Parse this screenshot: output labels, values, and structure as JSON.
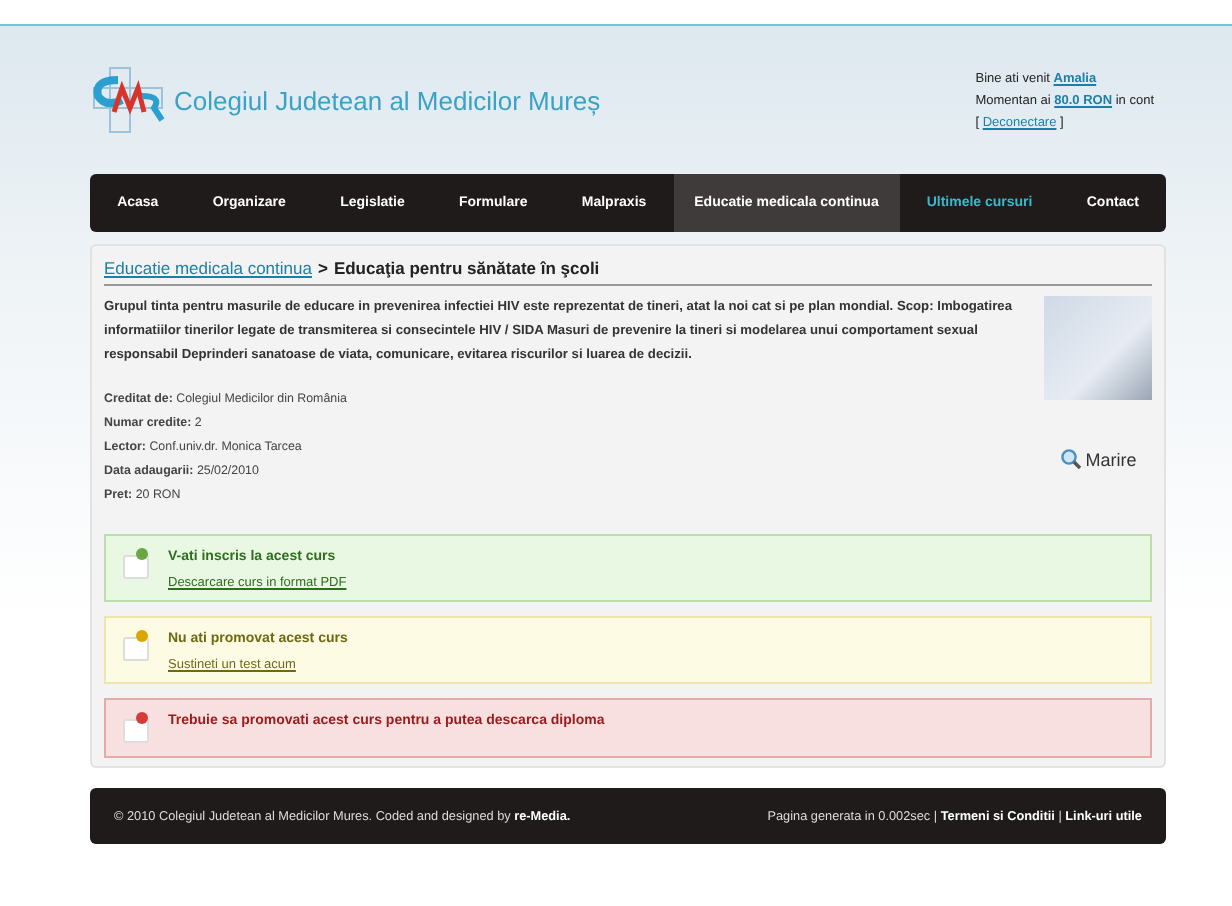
{
  "header": {
    "site_title": "Colegiul Judetean al Medicilor Mureș",
    "user": {
      "greeting": "Bine ati venit",
      "name": "Amalia",
      "balance_prefix": "Momentan ai",
      "balance": "80.0 RON",
      "balance_suffix": "in cont",
      "logout_open": "[",
      "logout": "Deconectare",
      "logout_close": "]"
    }
  },
  "nav": [
    {
      "label": "Acasa",
      "selected": false,
      "accent": false
    },
    {
      "label": "Organizare",
      "selected": false,
      "accent": false
    },
    {
      "label": "Legislatie",
      "selected": false,
      "accent": false
    },
    {
      "label": "Formulare",
      "selected": false,
      "accent": false
    },
    {
      "label": "Malpraxis",
      "selected": false,
      "accent": false
    },
    {
      "label": "Educatie medicala continua",
      "selected": true,
      "accent": false
    },
    {
      "label": "Ultimele cursuri",
      "selected": false,
      "accent": true
    },
    {
      "label": "Contact",
      "selected": false,
      "accent": false
    }
  ],
  "breadcrumb": {
    "link": "Educatie medicala continua",
    "separator": ">",
    "current": "Educaţia pentru sănătate în şcoli"
  },
  "course": {
    "description": "Grupul tinta pentru masurile de educare in prevenirea infectiei HIV este reprezentat de tineri, atat la noi cat si pe plan mondial. Scop: Imbogatirea informatiilor tinerilor legate de transmiterea si consecintele HIV / SIDA Masuri de prevenire la tineri si modelarea unui comportament sexual responsabil Deprinderi sanatoase de viata, comunicare, evitarea riscurilor si luarea de decizii.",
    "details": [
      {
        "label": "Creditat de:",
        "value": "Colegiul Medicilor din România"
      },
      {
        "label": "Numar credite:",
        "value": "2"
      },
      {
        "label": "Lector:",
        "value": "Conf.univ.dr. Monica Tarcea"
      },
      {
        "label": "Data adaugarii:",
        "value": "25/02/2010"
      },
      {
        "label": "Pret:",
        "value": "20 RON"
      }
    ],
    "zoom_label": "Marire"
  },
  "messages": [
    {
      "kind": "success",
      "title": "V-ati inscris la acest curs",
      "link": "Descarcare curs in format PDF"
    },
    {
      "kind": "warning",
      "title": "Nu ati promovat acest curs",
      "link": "Sustineti un test acum"
    },
    {
      "kind": "error",
      "title": "Trebuie sa promovati acest curs pentru a putea descarca diploma"
    }
  ],
  "footer": {
    "copyright": "© 2010 Colegiul Judetean al Medicilor Mures. Coded and designed by",
    "designer": "re-Media.",
    "generated": "Pagina generata in 0.002sec",
    "separator": "|",
    "links": [
      "Termeni si Conditii",
      "Link-uri utile"
    ]
  }
}
